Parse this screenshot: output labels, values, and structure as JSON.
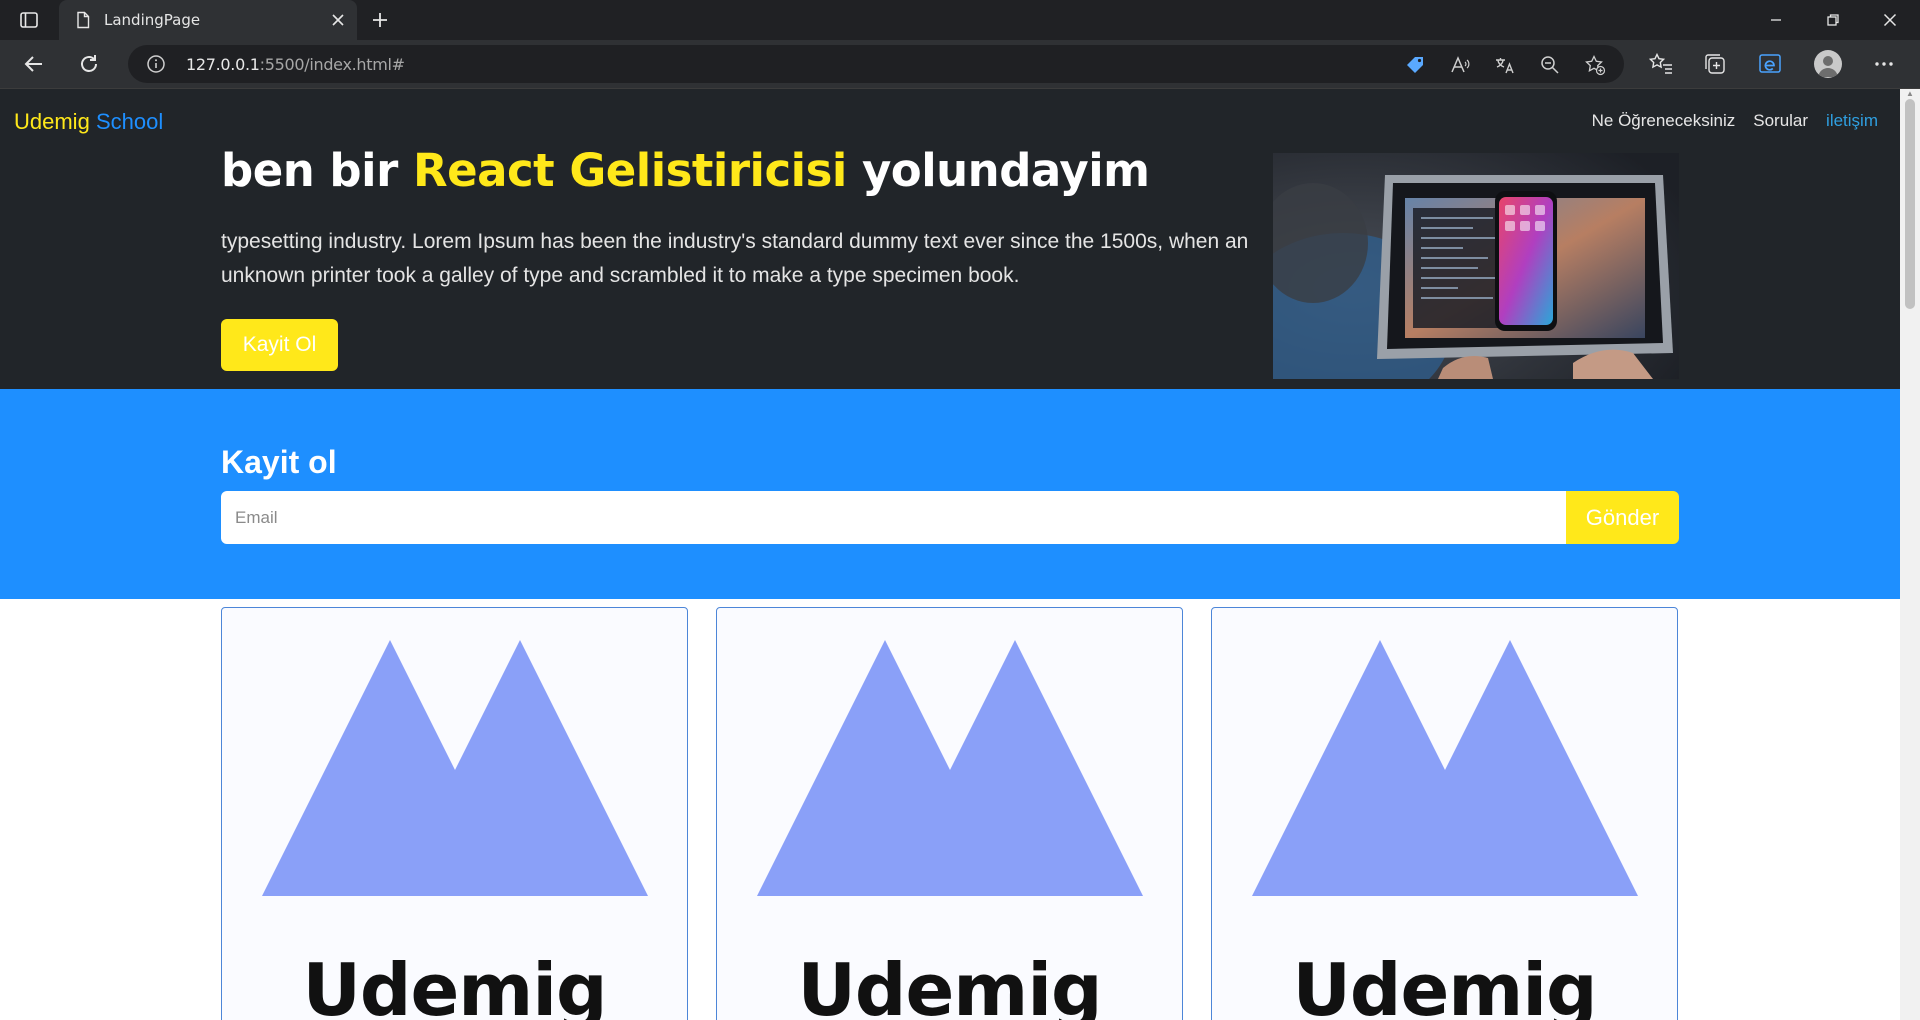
{
  "browser": {
    "tab_title": "LandingPage",
    "url_host": "127.0.0.1",
    "url_rest": ":5500/index.html#"
  },
  "page": {
    "brand": {
      "part1": "Udemig",
      "part2": "School"
    },
    "nav": {
      "items": [
        {
          "label": "Ne Öğreneceksiniz",
          "active": false
        },
        {
          "label": "Sorular",
          "active": false
        },
        {
          "label": "iletişim",
          "active": true
        }
      ]
    },
    "hero": {
      "title_before": "ben bir ",
      "title_highlight": "React Gelistiricisi",
      "title_after": " yolundayim",
      "text": "typesetting industry. Lorem Ipsum has been the industry's standard dummy text ever since the 1500s, when an unknown printer took a galley of type and scrambled it to make a type specimen book.",
      "button": "Kayit Ol",
      "image_icon": "laptop-photo"
    },
    "signup": {
      "title": "Kayit ol",
      "email_placeholder": "Email",
      "email_value": "",
      "button": "Gönder"
    },
    "cards": [
      {
        "word": "Udemig",
        "logo_icon": "udemig-logo-icon"
      },
      {
        "word": "Udemig",
        "logo_icon": "udemig-logo-icon"
      },
      {
        "word": "Udemig",
        "logo_icon": "udemig-logo-icon"
      }
    ]
  },
  "colors": {
    "accent_yellow": "#ffe81a",
    "accent_blue": "#1e8fff",
    "hero_bg": "#212529",
    "logo_blue": "#8aa0f8"
  }
}
